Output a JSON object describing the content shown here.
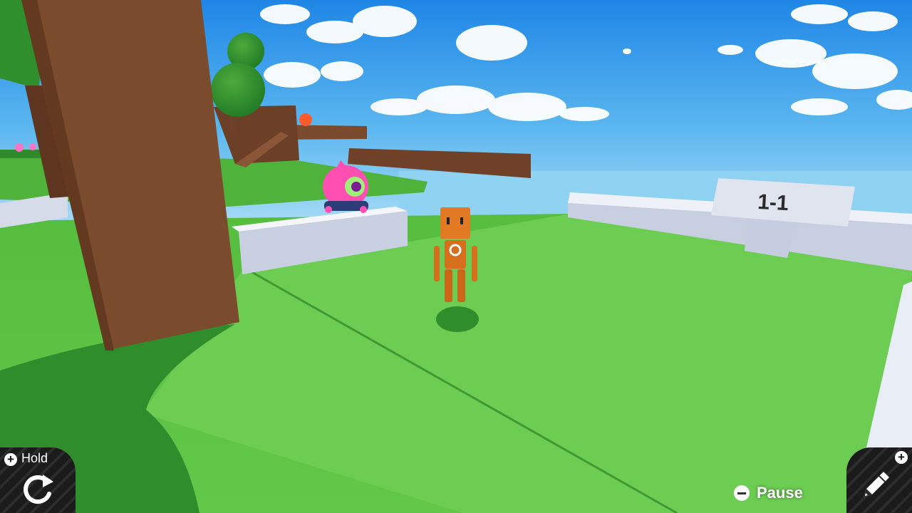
{
  "level_sign": {
    "text": "1-1"
  },
  "hud": {
    "hold": {
      "label": "Hold",
      "button_icon": "plus-button-icon",
      "action_icon": "rotate-icon"
    },
    "pause": {
      "label": "Pause",
      "button_icon": "minus-button-icon"
    },
    "edit": {
      "button_icon": "plus-button-icon",
      "action_icon": "pencil-icon"
    }
  },
  "colors": {
    "sky_top": "#1f86e6",
    "sky_horizon": "#a8dcf5",
    "grass": "#5cbf45",
    "grass_light": "#6dcc55",
    "wood": "#7a4a2e",
    "wall": "#dfe4f0",
    "robot": "#e27a23",
    "enemy": "#ff4fb3"
  }
}
